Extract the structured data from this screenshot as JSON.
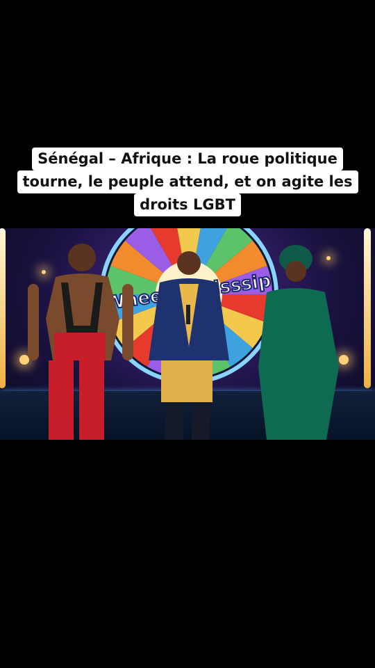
{
  "caption": {
    "lines": [
      "Sénégal – Afrique : La roue politique",
      "tourne, le peuple attend, et on agite les",
      "droits LGBT"
    ]
  },
  "scene": {
    "wheel_text": "Wheel of Cisssip",
    "colors": {
      "background": "#000000",
      "caption_bg": "#ffffff",
      "caption_text": "#111111",
      "wheel_rim": "#8ad4ff",
      "stage_light": "#2e8fd6"
    }
  }
}
